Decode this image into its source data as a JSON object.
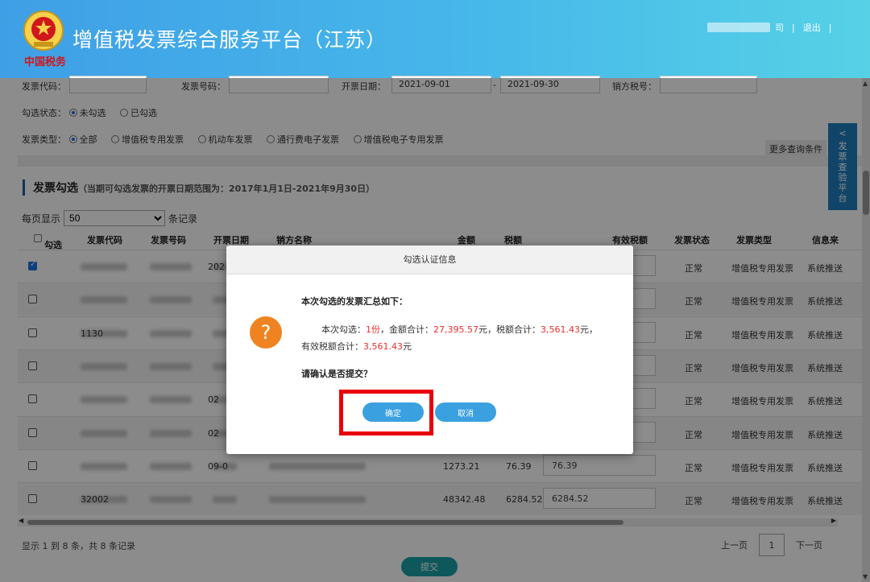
{
  "header": {
    "logo_text": "中国税务",
    "title": "增值税发票综合服务平台（江苏）",
    "company_suffix": "司",
    "logout": "退出"
  },
  "filters": {
    "invoice_code_label": "发票代码：",
    "invoice_number_label": "发票号码：",
    "issue_date_label": "开票日期：",
    "date_from": "2021-09-01",
    "date_sep": "-",
    "date_to": "2021-09-30",
    "seller_tax_label": "销方税号：",
    "check_status_label": "勾选状态：",
    "check_status_options": [
      "未勾选",
      "已勾选"
    ],
    "invoice_type_label": "发票类型：",
    "invoice_type_options": [
      "全部",
      "增值税专用发票",
      "机动车发票",
      "通行费电子发票",
      "增值税电子专用发票"
    ],
    "more_conditions": "更多查询条件"
  },
  "side_tab": {
    "arrow": "<",
    "label": "发票查验平台"
  },
  "section": {
    "title": "发票勾选",
    "note": "（当期可勾选发票的开票日期范围为：2017年1月1日-2021年9月30日）"
  },
  "per_page": {
    "label": "每页显示",
    "value": "50",
    "suffix": "条记录"
  },
  "table": {
    "headers": [
      "勾选",
      "发票代码",
      "发票号码",
      "开票日期",
      "销方名称",
      "金额",
      "税额",
      "有效税额",
      "发票状态",
      "发票类型",
      "信息来"
    ],
    "rows": [
      {
        "checked": true,
        "date": "202",
        "amount": "",
        "tax": "",
        "valid_tax": "",
        "status": "正常",
        "type": "增值税专用发票",
        "source": "系统推送"
      },
      {
        "checked": false,
        "date": "",
        "amount": "",
        "tax": "",
        "valid_tax": "",
        "status": "正常",
        "type": "增值税专用发票",
        "source": "系统推送"
      },
      {
        "checked": false,
        "code_partial": "1130",
        "date": "",
        "amount": "",
        "tax": "",
        "valid_tax": "",
        "status": "正常",
        "type": "增值税专用发票",
        "source": "系统推送"
      },
      {
        "checked": false,
        "date": "",
        "amount": "",
        "tax": "",
        "valid_tax": "",
        "status": "正常",
        "type": "增值税专用发票",
        "source": "系统推送"
      },
      {
        "checked": false,
        "date": "02",
        "amount": "",
        "tax": "",
        "valid_tax": "",
        "status": "正常",
        "type": "增值税专用发票",
        "source": "系统推送"
      },
      {
        "checked": false,
        "date": "02",
        "amount": "",
        "tax": "",
        "valid_tax": "",
        "status": "正常",
        "type": "增值税专用发票",
        "source": "系统推送"
      },
      {
        "checked": false,
        "date": "09-0",
        "amount": "1273.21",
        "tax": "76.39",
        "valid_tax": "76.39",
        "status": "正常",
        "type": "增值税专用发票",
        "source": "系统推送"
      },
      {
        "checked": false,
        "code_partial": "32002",
        "date": "",
        "amount": "48342.48",
        "tax": "6284.52",
        "valid_tax": "6284.52",
        "status": "正常",
        "type": "增值税专用发票",
        "source": "系统推送"
      }
    ]
  },
  "footer": {
    "info": "显示 1 到 8 条，共 8 条记录",
    "prev": "上一页",
    "page": "1",
    "next": "下一页",
    "submit": "提交"
  },
  "dialog": {
    "title": "勾选认证信息",
    "icon": "?",
    "line1": "本次勾选的发票汇总如下：",
    "count_prefix": "本次勾选：",
    "count": "1份",
    "amount_prefix": "，金额合计：",
    "amount": "27,395.57",
    "tax_prefix": "元，税额合计：",
    "tax": "3,561.43",
    "tax_suffix": "元，",
    "valid_prefix": "有效税额合计：",
    "valid": "3,561.43",
    "valid_suffix": "元",
    "confirm_question": "请确认是否提交？",
    "ok": "确定",
    "cancel": "取消"
  },
  "colors": {
    "header_start": "#3f9fe6",
    "header_end": "#56d1e6",
    "dialog_button": "#3aa0e0",
    "highlight": "#e8000c",
    "warning_icon": "#f08321",
    "emphasis_text": "#e8302e"
  }
}
